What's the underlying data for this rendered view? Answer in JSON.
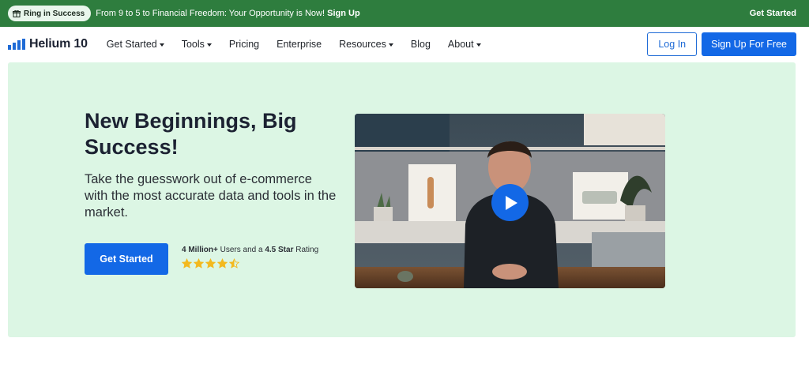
{
  "promo": {
    "badge": "Ring in Success",
    "text": "From 9 to 5 to Financial Freedom: Your Opportunity is Now! ",
    "text_link": "Sign Up",
    "right_link": "Get Started",
    "bg_color": "#2e7d3e"
  },
  "nav": {
    "logo_text": "Helium 10",
    "items": [
      {
        "label": "Get Started",
        "dropdown": true
      },
      {
        "label": "Tools",
        "dropdown": true
      },
      {
        "label": "Pricing",
        "dropdown": false
      },
      {
        "label": "Enterprise",
        "dropdown": false
      },
      {
        "label": "Resources",
        "dropdown": true
      },
      {
        "label": "Blog",
        "dropdown": false
      },
      {
        "label": "About",
        "dropdown": true
      }
    ],
    "login_label": "Log In",
    "signup_label": "Sign Up For Free"
  },
  "hero": {
    "title": "New Beginnings, Big Success!",
    "subtitle": "Take the guesswork out of e-commerce with the most accurate data and tools in the market.",
    "cta_label": "Get Started",
    "rating": {
      "users_bold": "4 Million+",
      "users_text": " Users and a ",
      "stars_bold": "4.5 Star",
      "stars_text": " Rating",
      "value": 4.5,
      "max": 5,
      "star_color": "#f3b91f"
    },
    "bg_color": "#dcf6e4"
  },
  "video": {
    "play_icon": "play-icon",
    "accent_color": "#1368e6"
  }
}
